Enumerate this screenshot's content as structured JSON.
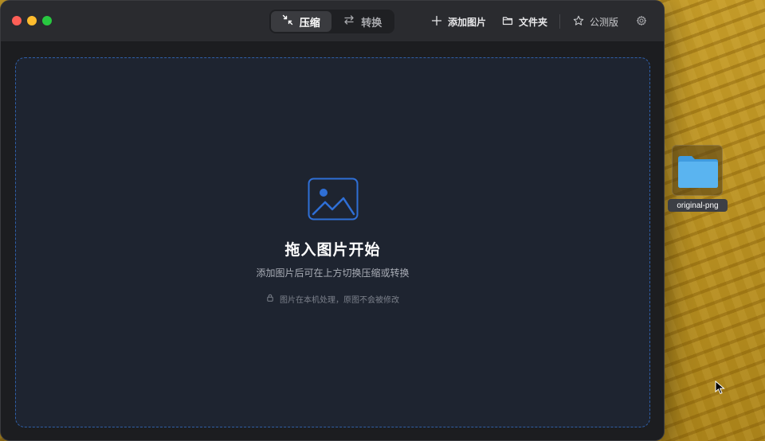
{
  "window": {
    "segment": {
      "compress_label": "压缩",
      "convert_label": "转换"
    },
    "toolbar": {
      "add_image_label": "添加图片",
      "folder_label": "文件夹",
      "public_beta_label": "公测版"
    }
  },
  "dropzone": {
    "title": "拖入图片开始",
    "subtitle": "添加图片后可在上方切换压缩或转换",
    "privacy_note": "图片在本机处理，原图不会被修改"
  },
  "desktop": {
    "folder_name": "original-png"
  },
  "colors": {
    "accent_blue": "#2f6fd6",
    "window_bg": "#1c1d20",
    "titlebar_bg": "#2a2b2f"
  }
}
